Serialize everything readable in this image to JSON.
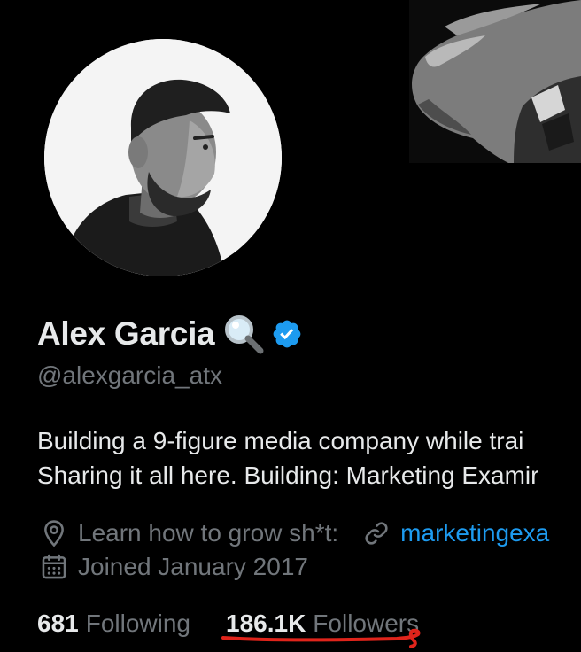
{
  "profile": {
    "display_name": "Alex Garcia",
    "name_emoji_icon": "magnifying-glass-icon",
    "verified_icon": "verified-badge-icon",
    "handle": "@alexgarcia_atx",
    "bio_lines": [
      "Building a 9-figure media company while trai",
      "Sharing it all here. Building: Marketing Examir"
    ],
    "location": "Learn how to grow sh*t:",
    "website": "marketingexa",
    "joined": "Joined January 2017"
  },
  "stats": {
    "following_count": "681",
    "following_label": "Following",
    "followers_count": "186.1K",
    "followers_label": "Followers"
  },
  "colors": {
    "background": "#000000",
    "text": "#e7e9ea",
    "muted": "#71767b",
    "link": "#1d9bf0",
    "verified": "#1d9bf0",
    "annotation": "#e0241b"
  }
}
